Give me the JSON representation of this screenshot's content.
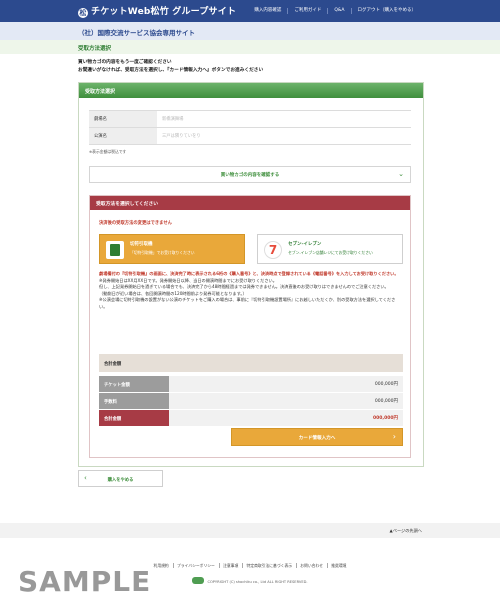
{
  "header": {
    "logo_text": "チケットWeb松竹 グループサイト",
    "nav": [
      "購入内容確認",
      "ご利用ガイド",
      "Q&A",
      "ログアウト（購入をやめる）"
    ]
  },
  "org": {
    "title": "（社）国際交流サービス協会専用サイト"
  },
  "page": {
    "title": "受取方法選択"
  },
  "intro": {
    "line1": "買い物カゴの内容をもう一度ご確認ください",
    "line2": "お間違いがなければ、受取方法を選択し、『カード情報入力へ』ボタンでお進みください"
  },
  "panel": {
    "title": "受取方法選択"
  },
  "info": {
    "rows": [
      {
        "label": "劇場名",
        "value": "新橋演舞場"
      },
      {
        "label": "公演名",
        "value": "三戸は隣りていをり"
      }
    ],
    "note": "※表示金額は税込です"
  },
  "cart_button": "買い物カゴの内容を確認する",
  "receive": {
    "title": "受取方法を選択してください",
    "warning": "決済後の受取方法の変更はできません",
    "options": [
      {
        "name": "切符引取機",
        "desc": "「切符引取機」でお受け取りください"
      },
      {
        "name": "セブン-イレブン",
        "desc": "セブン-イレブン店舗レジにてお受け取りください"
      }
    ],
    "desc_red": "劇場備付の『切符引取機』の画面に、決済完了時に表示される6桁の《購入番号》と、決済時点で登録されている《電話番号》を入力してお受け取りください。",
    "desc_lines": [
      "※発券開始日はXX月XX日です。発券開始日以降、当日の開演時間までにお受け取りください。",
      "但し、上記発券開始日を過ぎている場合でも、決済完了から48時間経過までは発券できません。決済直後のお受け取りはできませんのでご注意ください。",
      "（動劇日が近い場合は、各回開演時間の120時間前より発券可能となります。）",
      "※公演会場に切符引取機の設置がない公演のチケットをご購入の場合は、事前に『切符引取機設置場所』にお越しいただくか、別の受取方法を選択してください。"
    ]
  },
  "totals": {
    "header": "合計金額",
    "rows": [
      {
        "label": "チケット金額",
        "value": "000,000円"
      },
      {
        "label": "手数料",
        "value": "000,000円"
      },
      {
        "label": "合計金額",
        "value": "000,000円"
      }
    ]
  },
  "card_button": "カード情報入力へ",
  "back_button": "購入をやめる",
  "page_top": "▲ページの先頭へ",
  "footer": {
    "links": [
      "利用規約",
      "プライバシーポリシー",
      "注意事項",
      "特定商取引法に基づく表示",
      "お問い合わせ",
      "推奨環境"
    ],
    "copyright": "COPYRIGHT (C) shochiku co., Ltd ALL RIGHT RESERVED."
  },
  "watermark": "SAMPLE"
}
